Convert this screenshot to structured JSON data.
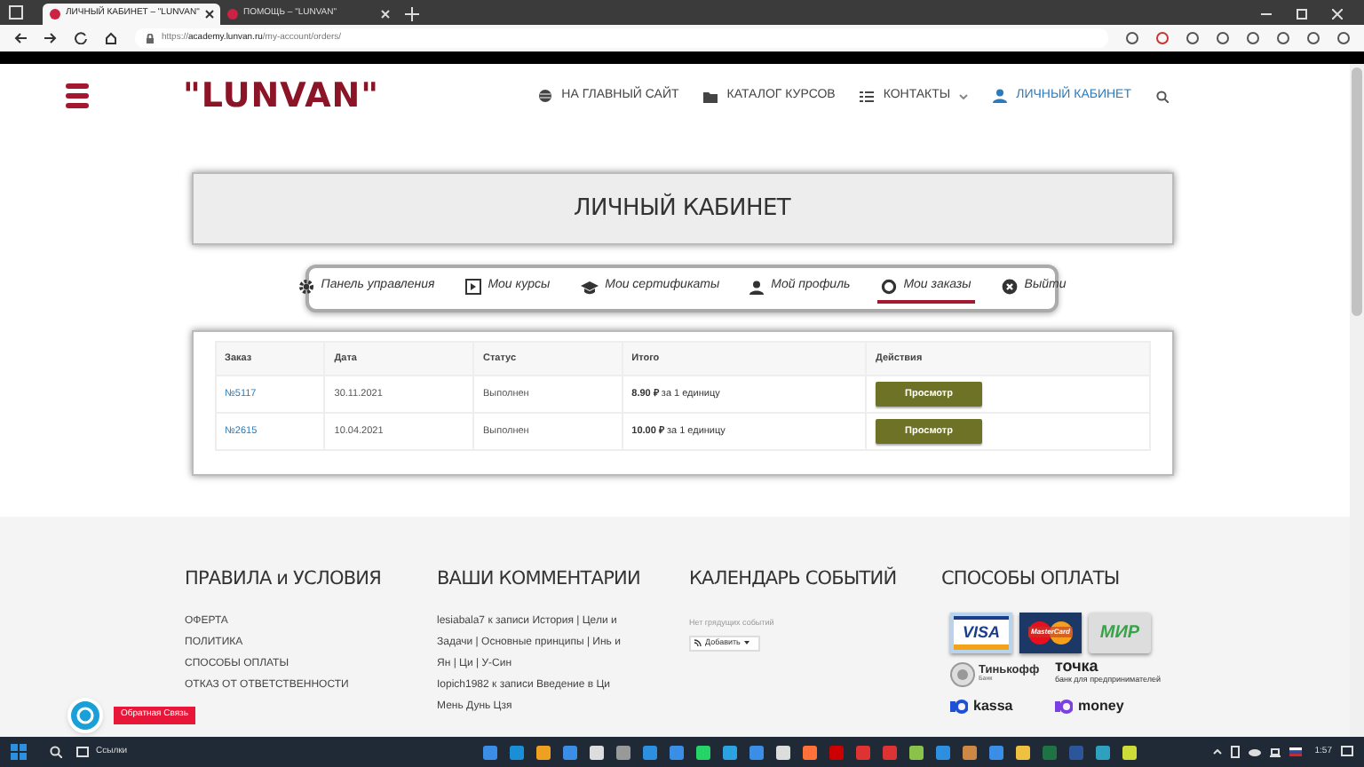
{
  "browser": {
    "tabs": [
      {
        "title": "ЛИЧНЫЙ КАБИНЕТ – \"LUNVAN\"",
        "selected": true
      },
      {
        "title": "ПОМОЩЬ – \"LUNVAN\"",
        "selected": false
      }
    ],
    "url_prefix": "https://",
    "url_host": "academy.lunvan.ru",
    "url_path": "/my-account/orders/"
  },
  "header": {
    "logo": "\"LUNVAN\"",
    "nav": [
      {
        "label": "НА ГЛАВНЫЙ САЙТ",
        "selected": false,
        "dropdown": false
      },
      {
        "label": "КАТАЛОГ КУРСОВ",
        "selected": false,
        "dropdown": false
      },
      {
        "label": "КОНТАКТЫ",
        "selected": false,
        "dropdown": true
      },
      {
        "label": "ЛИЧНЫЙ КАБИНЕТ",
        "selected": true,
        "dropdown": false
      }
    ]
  },
  "page_title": "ЛИЧНЫЙ КАБИНЕТ",
  "account_tabs": [
    {
      "label": "Панель управления",
      "selected": false
    },
    {
      "label": "Мои курсы",
      "selected": false
    },
    {
      "label": "Мои сертификаты",
      "selected": false
    },
    {
      "label": "Мой профиль",
      "selected": false
    },
    {
      "label": "Мои заказы",
      "selected": true
    },
    {
      "label": "Выйти",
      "selected": false
    }
  ],
  "orders": {
    "columns": [
      "Заказ",
      "Дата",
      "Статус",
      "Итого",
      "Действия"
    ],
    "rows": [
      {
        "order": "№5117",
        "date": "30.11.2021",
        "status": "Выполнен",
        "total": "**8.90 ₽** за 1 единицу",
        "action": "Просмотр"
      },
      {
        "order": "№2615",
        "date": "10.04.2021",
        "status": "Выполнен",
        "total": "**10.00 ₽** за 1 единицу",
        "action": "Просмотр"
      }
    ]
  },
  "footer": {
    "terms": {
      "heading": "ПРАВИЛА и УСЛОВИЯ",
      "links": [
        "ОФЕРТА",
        "ПОЛИТИКА",
        "СПОСОБЫ ОПЛАТЫ",
        "ОТКАЗ ОТ ОТВЕТСТВЕННОСТИ"
      ]
    },
    "comments": {
      "heading": "ВАШИ КОММЕНТАРИИ",
      "items": [
        {
          "author": "lesiabala7",
          "text": " к записи ",
          "post": "История | Цели и Задачи | Основные принципы | Инь и Ян | Ци | У-Син"
        },
        {
          "author": "Iopich1982",
          "text": " к записи ",
          "post": "Введение в Ци Мень Дунь Цзя"
        }
      ]
    },
    "calendar": {
      "heading": "КАЛЕНДАРЬ СОБЫТИЙ",
      "note": "Нет грядущих событий",
      "button": "Добавить"
    },
    "payments": {
      "heading": "СПОСОБЫ ОПЛАТЫ",
      "logos": [
        {
          "kind": "visa",
          "label": "VISA"
        },
        {
          "kind": "mastercard",
          "label": "MasterCard"
        },
        {
          "kind": "mir",
          "label": "МИР"
        },
        {
          "kind": "tinkoff",
          "label": "Тинькофф",
          "sub": "Банк"
        },
        {
          "kind": "tochka",
          "label": "точка",
          "sub": "банк для предпринимателей"
        },
        {
          "kind": "kassa",
          "label": "kassa"
        },
        {
          "kind": "money",
          "label": "money"
        }
      ]
    }
  },
  "chat": {
    "label": "Обратная Связь"
  },
  "taskbar": {
    "search_label": "Ссылки",
    "time": "1:57"
  }
}
